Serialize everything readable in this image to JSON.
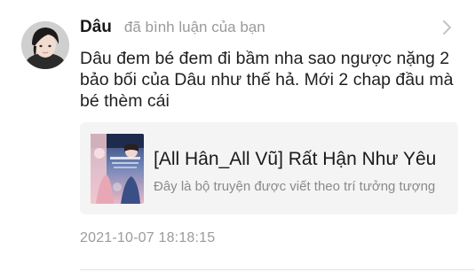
{
  "notification": {
    "username": "Dâu",
    "action": "đã bình luận của bạn",
    "comment": "Dâu đem bé đem đi bầm nha sao ngược nặng 2 bảo bối của Dâu như thế hả. Mới 2 chap đầu mà bé thèm cái",
    "timestamp": "2021-10-07 18:18:15"
  },
  "story_card": {
    "title": "[All Hân_All Vũ] Rất Hận Như Yêu",
    "description": "Đây là bộ truyện được viết theo trí tưởng tượng"
  },
  "icons": {
    "avatar": "user-avatar-photo",
    "chevron": "chevron-right-icon",
    "cover": "story-cover-image"
  },
  "colors": {
    "card_background": "#f4f4f4",
    "muted_text": "#9a9a9a",
    "primary_text": "#1a1a1a"
  }
}
